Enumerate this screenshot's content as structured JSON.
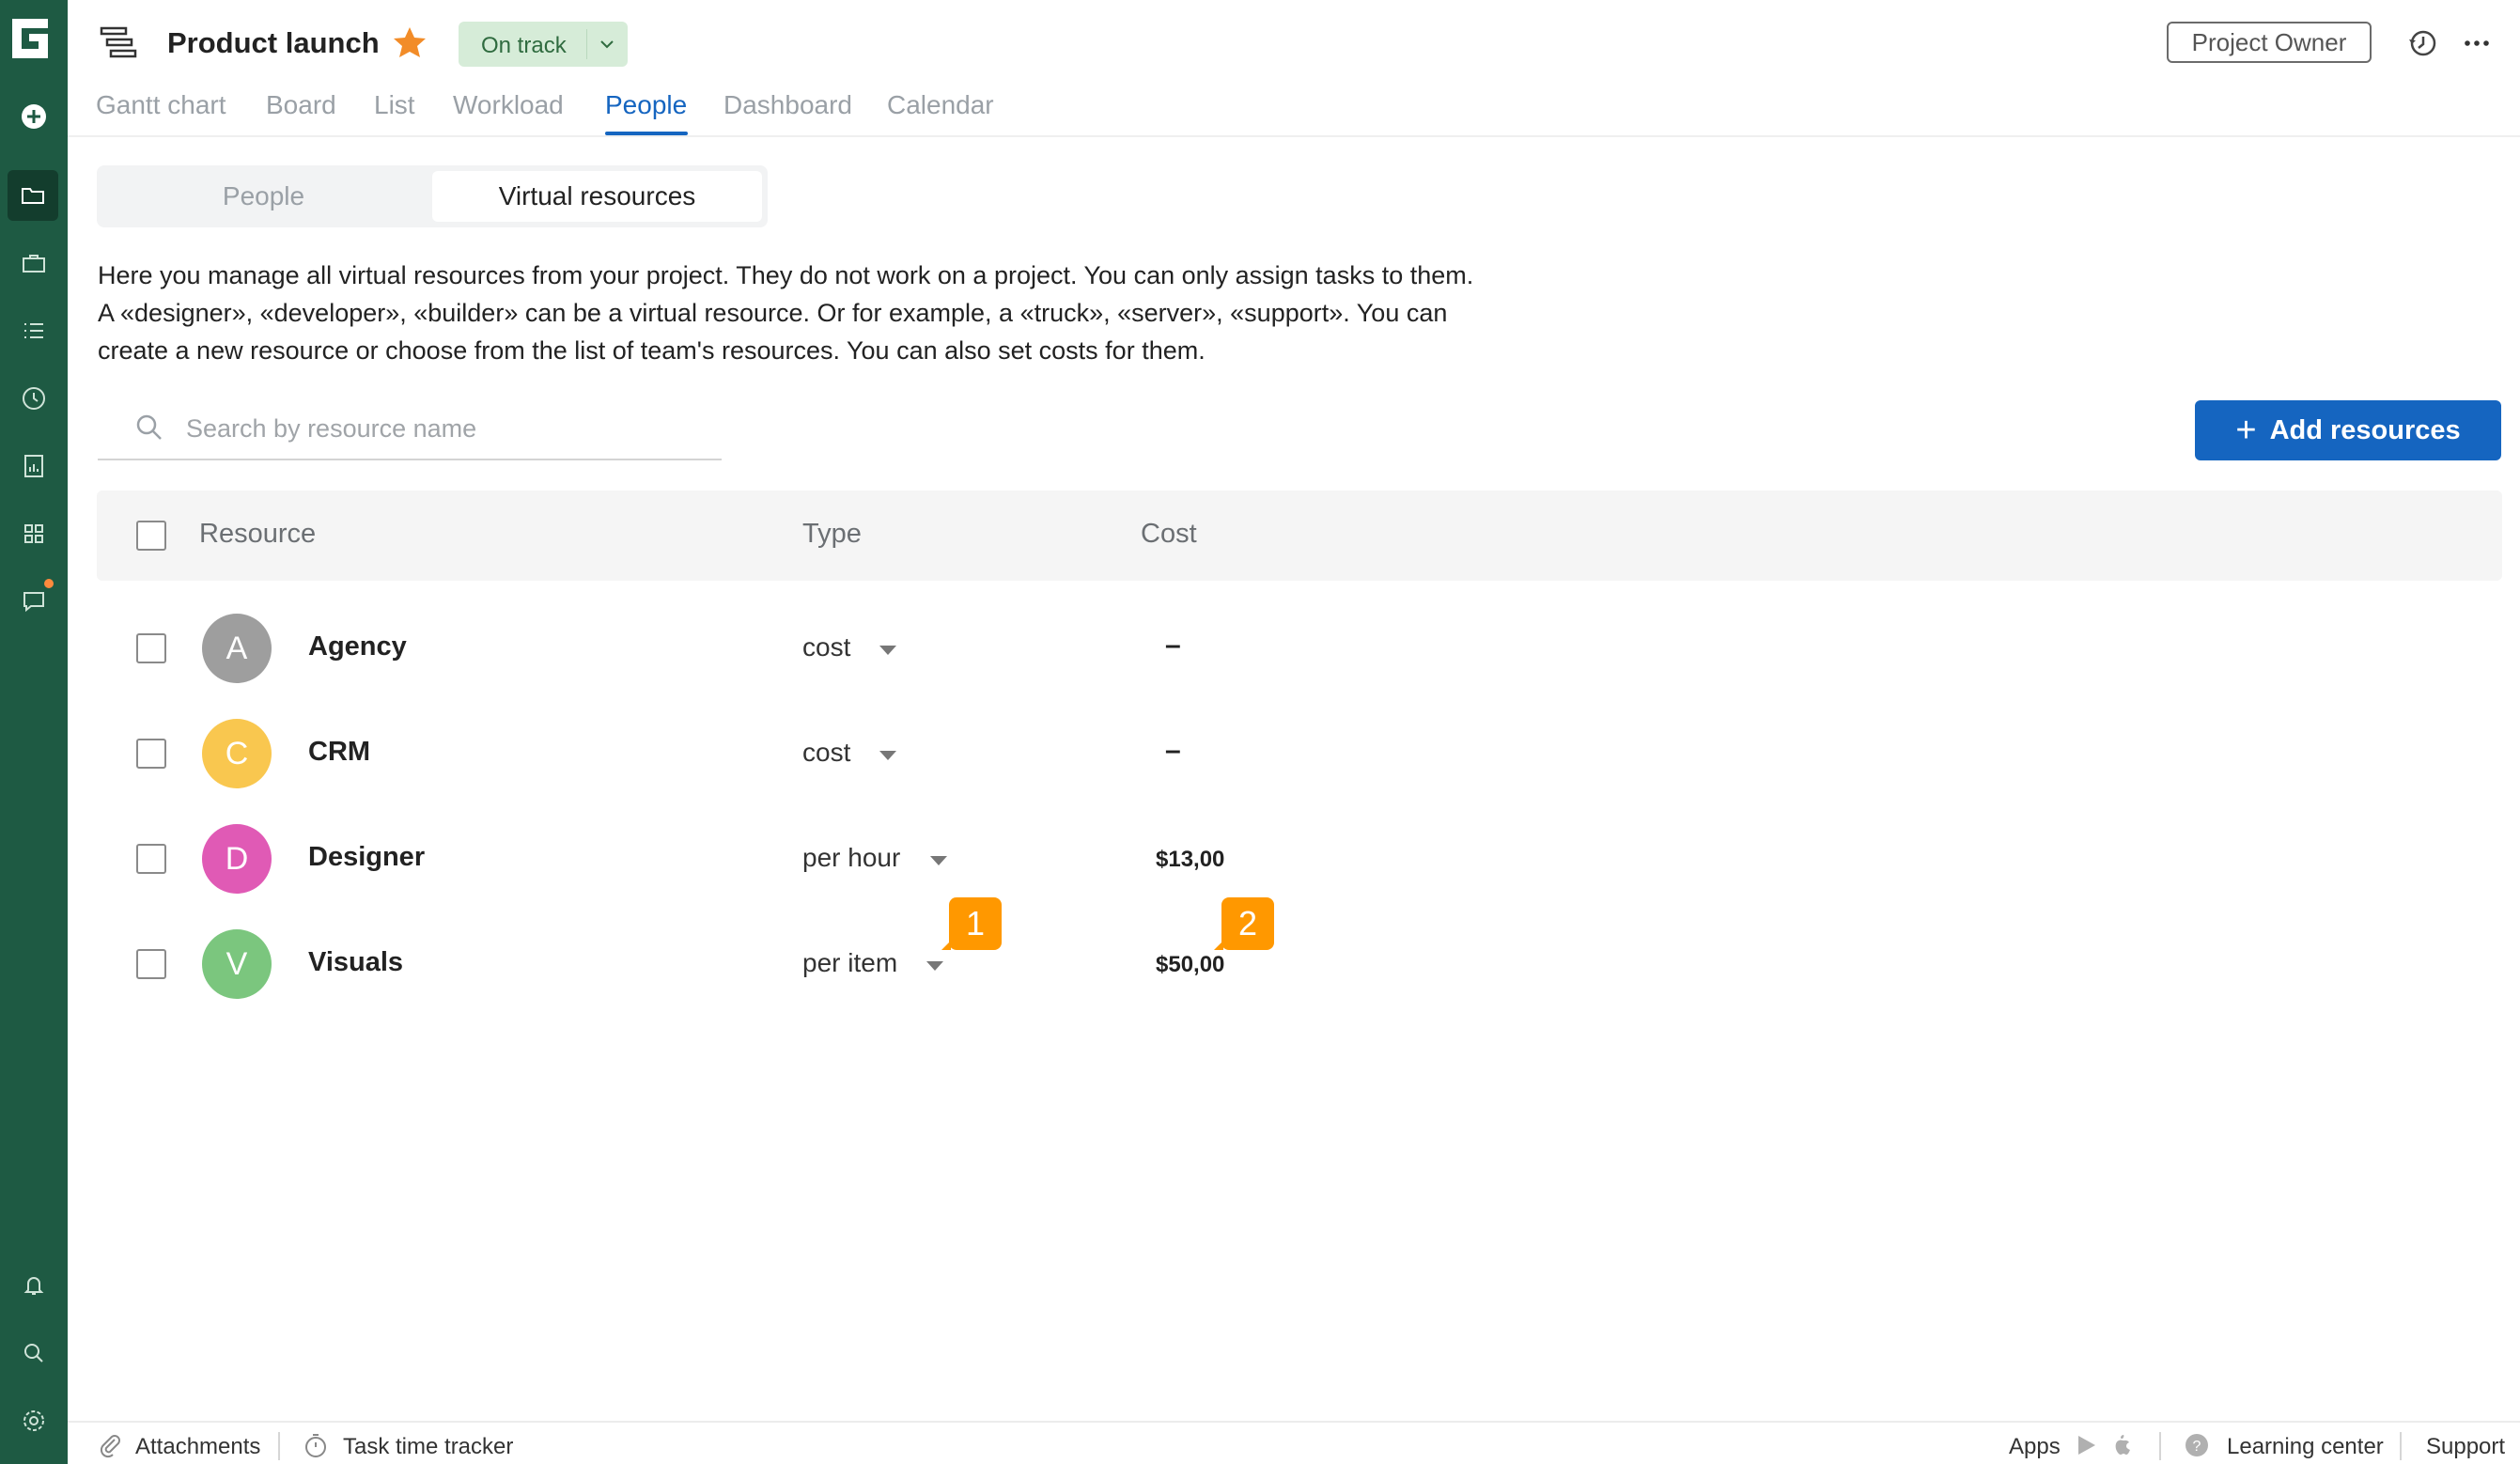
{
  "app": {
    "logo_letter": "G",
    "accent": "#1565c0",
    "rail_color": "#1e5a43"
  },
  "header": {
    "project_title": "Product launch",
    "status": "On track",
    "owner_button": "Project Owner"
  },
  "tabs": [
    {
      "label": "Gantt chart"
    },
    {
      "label": "Board"
    },
    {
      "label": "List"
    },
    {
      "label": "Workload"
    },
    {
      "label": "People",
      "active": true
    },
    {
      "label": "Dashboard"
    },
    {
      "label": "Calendar"
    }
  ],
  "subtabs": {
    "people": "People",
    "virtual": "Virtual resources",
    "selected": "Virtual resources"
  },
  "description": "Here you manage all virtual resources from your project. They do not work on a project. You can only assign tasks to them. A «designer», «developer», «builder» can be a virtual resource. Or for example, a «truck», «server», «support». You can create a new resource or choose from the list of team's resources. You can also set costs for them.",
  "search": {
    "placeholder": "Search by resource name",
    "value": ""
  },
  "add_button": {
    "label": "Add resources"
  },
  "table": {
    "columns": {
      "resource": "Resource",
      "type": "Type",
      "cost": "Cost"
    },
    "rows": [
      {
        "initial": "A",
        "name": "Agency",
        "type": "cost",
        "cost": "–",
        "color": "#9e9e9e"
      },
      {
        "initial": "C",
        "name": "CRM",
        "type": "cost",
        "cost": "–",
        "color": "#f9c74f"
      },
      {
        "initial": "D",
        "name": "Designer",
        "type": "per hour",
        "cost": "$13,00",
        "color": "#e05ab5"
      },
      {
        "initial": "V",
        "name": "Visuals",
        "type": "per item",
        "cost": "$50,00",
        "color": "#7bc67e"
      }
    ]
  },
  "badges": [
    "1",
    "2"
  ],
  "footer": {
    "attachments": "Attachments",
    "time_tracker": "Task time tracker",
    "apps": "Apps",
    "learning_center": "Learning center",
    "support": "Support"
  },
  "icons": {
    "rail": [
      "add-icon",
      "folder-icon",
      "briefcase-icon",
      "list-icon",
      "clock-icon",
      "report-icon",
      "apps-grid-icon",
      "chat-icon",
      "bell-icon",
      "search-icon",
      "gear-icon"
    ],
    "header": [
      "project-gantt-icon",
      "star-icon",
      "chevron-down-icon",
      "history-icon",
      "more-icon"
    ]
  }
}
